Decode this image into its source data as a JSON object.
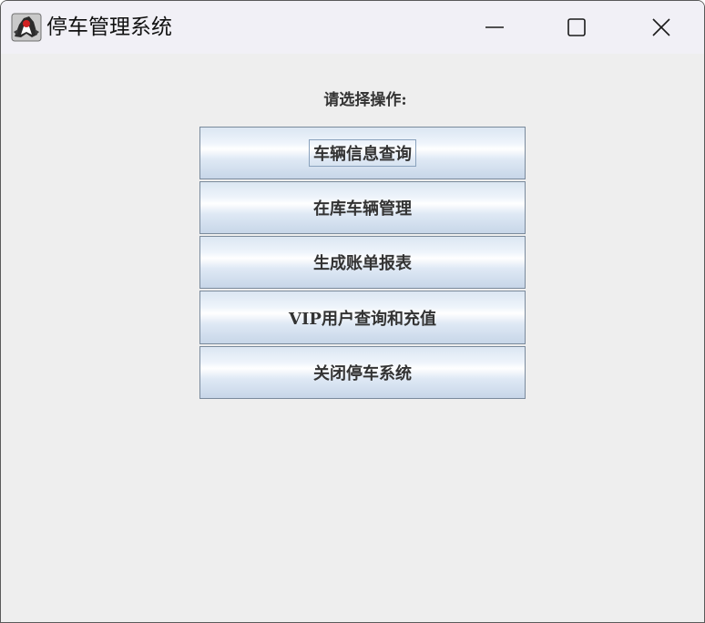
{
  "window": {
    "title": "停车管理系统",
    "icon": "java-duke-icon",
    "controls": {
      "minimize_icon": "minimize-icon",
      "maximize_icon": "maximize-icon",
      "close_icon": "close-icon"
    }
  },
  "main": {
    "prompt": "请选择操作:",
    "buttons": [
      {
        "label": "车辆信息查询",
        "focused": true
      },
      {
        "label": "在库车辆管理",
        "focused": false
      },
      {
        "label": "生成账单报表",
        "focused": false
      },
      {
        "label": "VIP用户查询和充值",
        "focused": false
      },
      {
        "label": "关闭停车系统",
        "focused": false
      }
    ]
  },
  "colors": {
    "window_bg": "#eeeeee",
    "titlebar_bg": "#f1f0f6",
    "button_border": "#7a8a9c",
    "button_gradient_top": "#dbe6f2",
    "button_gradient_bottom": "#c7d6e8",
    "text": "#333333"
  }
}
